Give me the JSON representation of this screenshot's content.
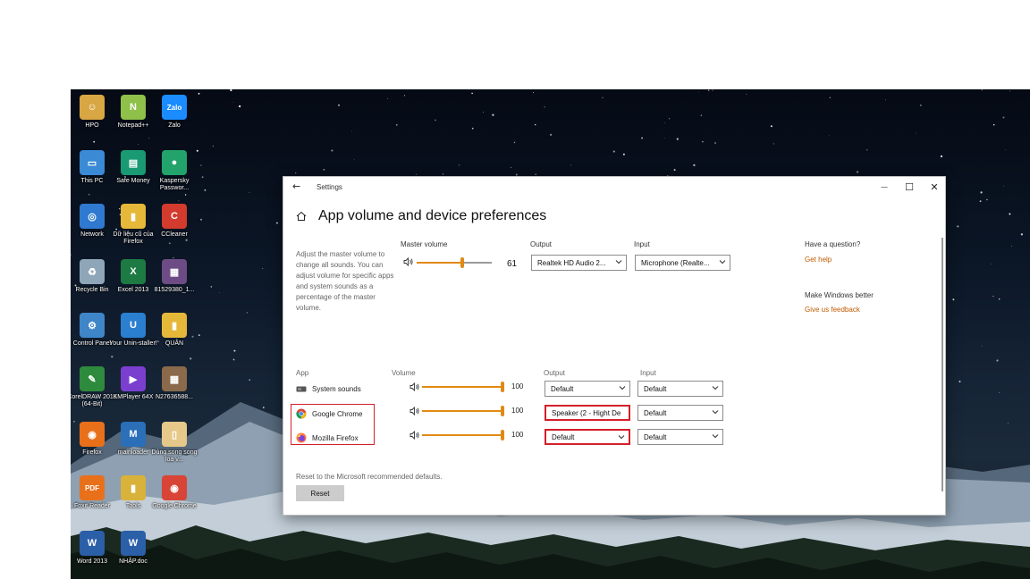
{
  "desktop_icons": [
    {
      "label": "HPO",
      "color": "#d8a642",
      "glyph": "☺"
    },
    {
      "label": "Notepad++",
      "color": "#8fc04a",
      "glyph": "N"
    },
    {
      "label": "Zalo",
      "color": "#1a8cff",
      "glyph": "Zalo"
    },
    {
      "label": "This PC",
      "color": "#3a8ad6",
      "glyph": "▭"
    },
    {
      "label": "Safe Money",
      "color": "#1a9a72",
      "glyph": "▤"
    },
    {
      "label": "Kaspersky Passwor...",
      "color": "#21a36b",
      "glyph": "●"
    },
    {
      "label": "Network",
      "color": "#2f7ad0",
      "glyph": "◎"
    },
    {
      "label": "Dữ liệu cũ của Firefox",
      "color": "#e6b83a",
      "glyph": "▮"
    },
    {
      "label": "CCleaner",
      "color": "#d23b2d",
      "glyph": "C"
    },
    {
      "label": "Recycle Bin",
      "color": "#8ea6b8",
      "glyph": "♻"
    },
    {
      "label": "Excel 2013",
      "color": "#1d7a43",
      "glyph": "X"
    },
    {
      "label": "81529380_1...",
      "color": "#6d4c85",
      "glyph": "▦"
    },
    {
      "label": "Control Panel",
      "color": "#3f86c8",
      "glyph": "⚙"
    },
    {
      "label": "Your Unin-staller!",
      "color": "#2b7fd0",
      "glyph": "U"
    },
    {
      "label": "QUÂN",
      "color": "#e6b83a",
      "glyph": "▮"
    },
    {
      "label": "CorelDRAW 2019 (64-Bit)",
      "color": "#2e8b3d",
      "glyph": "✎"
    },
    {
      "label": "KMPlayer 64X",
      "color": "#7b3fd0",
      "glyph": "▶"
    },
    {
      "label": "N27636588...",
      "color": "#8a6a4a",
      "glyph": "▦"
    },
    {
      "label": "Firefox",
      "color": "#e8701a",
      "glyph": "◉"
    },
    {
      "label": "mainloader",
      "color": "#2a6fb8",
      "glyph": "M"
    },
    {
      "label": "Dùng song song loa v...",
      "color": "#e6c98a",
      "glyph": "▯"
    },
    {
      "label": "Foxit Reader",
      "color": "#e8701a",
      "glyph": "PDF"
    },
    {
      "label": "Tools",
      "color": "#d8b23a",
      "glyph": "▮"
    },
    {
      "label": "Google Chrome",
      "color": "#d84436",
      "glyph": "◉"
    },
    {
      "label": "Word 2013",
      "color": "#2b5fa8",
      "glyph": "W"
    },
    {
      "label": "NHẬP.doc",
      "color": "#2b5fa8",
      "glyph": "W"
    }
  ],
  "window": {
    "app_name": "Settings",
    "back_label": "←",
    "minimize_label": "—",
    "maximize_label": "☐",
    "close_label": "✕"
  },
  "page": {
    "title": "App volume and device preferences",
    "description": "Adjust the master volume to change all sounds. You can adjust volume for specific apps and system sounds as a percentage of the master volume."
  },
  "master": {
    "label": "Master volume",
    "value": "61",
    "level": 0.61,
    "output_label": "Output",
    "output_value": "Realtek HD Audio 2...",
    "input_label": "Input",
    "input_value": "Microphone (Realte..."
  },
  "help": {
    "question": "Have a question?",
    "get_help": "Get help",
    "make_better": "Make Windows better",
    "feedback": "Give us feedback"
  },
  "apps_table": {
    "headers": {
      "app": "App",
      "volume": "Volume",
      "output": "Output",
      "input": "Input"
    },
    "rows": [
      {
        "name": "System sounds",
        "value": "100",
        "level": 1.0,
        "output": "Default",
        "input": "Default",
        "output_chev": true
      },
      {
        "name": "Google Chrome",
        "value": "100",
        "level": 1.0,
        "output": "Speaker (2 - Hight De",
        "input": "Default",
        "output_chev": false
      },
      {
        "name": "Mozilla Firefox",
        "value": "100",
        "level": 1.0,
        "output": "Default",
        "input": "Default",
        "output_chev": true
      }
    ]
  },
  "reset": {
    "text": "Reset to the Microsoft recommended defaults.",
    "button": "Reset"
  },
  "colors": {
    "accent": "#e08a14",
    "highlight": "#d4202a",
    "link": "#c05a00"
  }
}
